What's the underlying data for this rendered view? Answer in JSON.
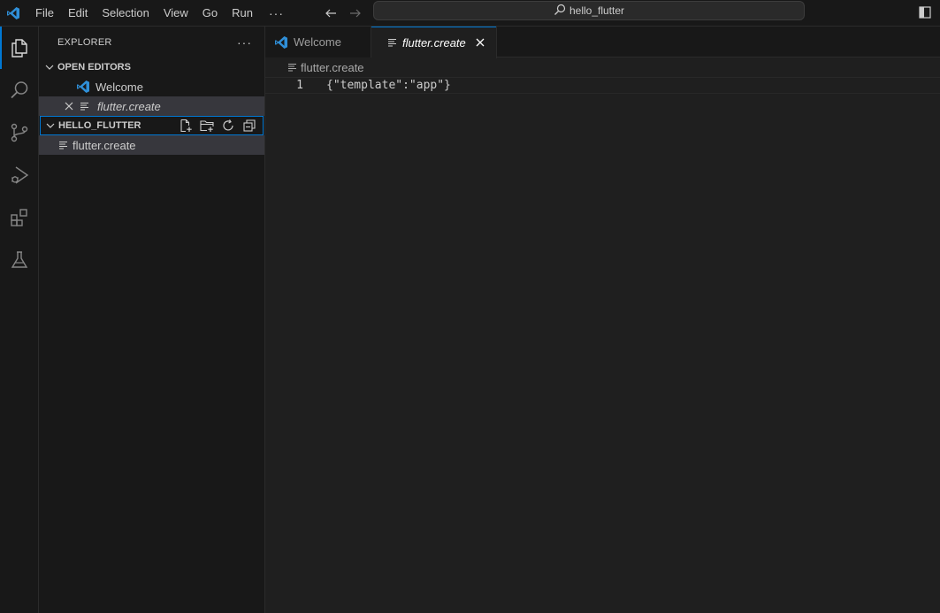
{
  "titlebar": {
    "menu": [
      "File",
      "Edit",
      "Selection",
      "View",
      "Go",
      "Run"
    ],
    "more": "···",
    "search_text": "hello_flutter"
  },
  "activity_bar": {
    "items": [
      "explorer-icon",
      "search-icon",
      "source-control-icon",
      "run-debug-icon",
      "extensions-icon",
      "testing-icon"
    ]
  },
  "sidebar": {
    "title": "EXPLORER",
    "more": "···",
    "open_editors": {
      "header": "OPEN EDITORS",
      "items": [
        {
          "label": "Welcome",
          "icon": "vscode-icon"
        },
        {
          "label": "flutter.create",
          "icon": "text-file-icon"
        }
      ]
    },
    "folder": {
      "header": "HELLO_FLUTTER",
      "items": [
        {
          "label": "flutter.create",
          "icon": "text-file-icon"
        }
      ]
    }
  },
  "editor": {
    "tabs": [
      {
        "label": "Welcome",
        "icon": "vscode-icon"
      },
      {
        "label": "flutter.create",
        "icon": "text-file-icon"
      }
    ],
    "breadcrumb": "flutter.create",
    "lines": [
      {
        "number": "1",
        "text": "{\"template\":\"app\"}"
      }
    ]
  },
  "colors": {
    "accent": "#0078d4",
    "vscode_blue": "#2f8fd8",
    "background": "#1f1f1f",
    "panel": "#181818"
  }
}
